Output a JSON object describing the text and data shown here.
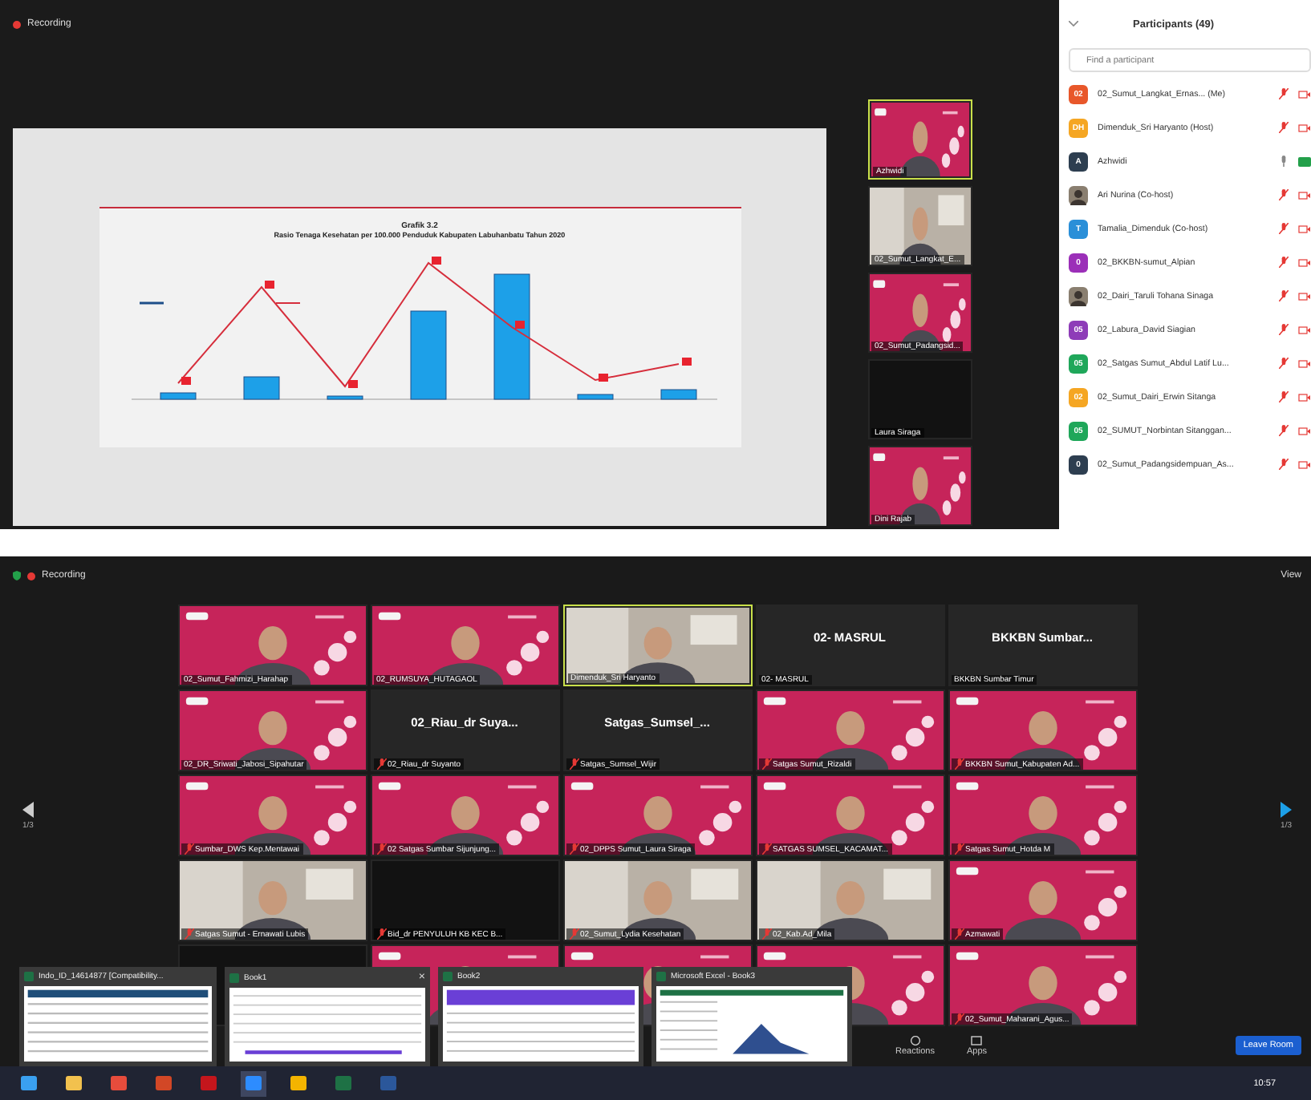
{
  "meeting_top": {
    "recording": "Recording",
    "slide": {
      "title": "Grafik 3.2",
      "subtitle": "Rasio Tenaga Kesehatan per 100.000 Penduduk Kabupaten Labuhanbatu Tahun 2020"
    },
    "speaker_strip": [
      {
        "name": "Azhwidi",
        "active": true,
        "kind": "backdrop"
      },
      {
        "name": "02_Sumut_Langkat_E...",
        "active": false,
        "kind": "room"
      },
      {
        "name": "02_Sumut_Padangsid...",
        "active": false,
        "kind": "backdrop"
      },
      {
        "name": "Laura Siraga",
        "active": false,
        "kind": "dark"
      },
      {
        "name": "Dini Rajab",
        "active": false,
        "kind": "backdrop"
      }
    ]
  },
  "participants_panel": {
    "title": "Participants (49)",
    "search": {
      "placeholder": "Find a participant"
    },
    "items": [
      {
        "kind": "initials",
        "initials": "02",
        "color": "#e8572a",
        "name": "02_Sumut_Langkat_Ernas... (Me)",
        "muted": true,
        "video_on": false
      },
      {
        "kind": "initials",
        "initials": "DH",
        "color": "#f5a623",
        "name": "Dimenduk_Sri Haryanto (Host)",
        "muted": true,
        "video_on": false
      },
      {
        "kind": "initials",
        "initials": "A",
        "color": "#2d3e50",
        "name": "Azhwidi",
        "muted": false,
        "video_on": true
      },
      {
        "name": "Ari Nurina (Co-host)",
        "muted": true,
        "video_on": false
      },
      {
        "kind": "initials",
        "initials": "T",
        "color": "#2a8fd8",
        "name": "Tamalia_Dimenduk (Co-host)",
        "muted": true,
        "video_on": false
      },
      {
        "kind": "initials",
        "initials": "0",
        "color": "#9b2fb8",
        "name": "02_BKKBN-sumut_Alpian",
        "muted": true,
        "video_on": false
      },
      {
        "name": "02_Dairi_Taruli Tohana Sinaga",
        "muted": true,
        "video_on": false
      },
      {
        "kind": "initials",
        "initials": "05",
        "color": "#8e3cb8",
        "name": "02_Labura_David Siagian",
        "muted": true,
        "video_on": false
      },
      {
        "kind": "initials",
        "initials": "05",
        "color": "#1fa75a",
        "name": "02_Satgas Sumut_Abdul Latif Lu...",
        "muted": true,
        "video_on": false
      },
      {
        "kind": "initials",
        "initials": "02",
        "color": "#f5a623",
        "name": "02_Sumut_Dairi_Erwin Sitanga",
        "muted": true,
        "video_on": false
      },
      {
        "kind": "initials",
        "initials": "05",
        "color": "#1fa75a",
        "name": "02_SUMUT_Norbintan Sitanggan...",
        "muted": true,
        "video_on": false
      },
      {
        "kind": "initials",
        "initials": "0",
        "color": "#2d3e50",
        "name": "02_Sumut_Padangsidempuan_As...",
        "muted": true,
        "video_on": false
      }
    ]
  },
  "meeting_bottom": {
    "recording": "Recording",
    "view": "View",
    "page_left": "1/3",
    "page_right": "1/3",
    "tiles": [
      {
        "kind": "backdrop",
        "name": "02_Sumut_Fahmizi_Harahap",
        "active": false,
        "muted": false
      },
      {
        "kind": "backdrop",
        "name": "02_RUMSUYA_HUTAGAOL",
        "active": false,
        "muted": false
      },
      {
        "kind": "room",
        "name": "Dimenduk_Sri Haryanto",
        "active": true,
        "muted": false
      },
      {
        "kind": "name",
        "big_name": "02- MASRUL",
        "name": "02- MASRUL",
        "active": false,
        "muted": false
      },
      {
        "kind": "name",
        "big_name": "BKKBN Sumbar...",
        "name": "BKKBN Sumbar Timur",
        "active": false,
        "muted": false
      },
      {
        "kind": "backdrop",
        "name": "02_DR_Sriwati_Jabosi_Sipahutar",
        "active": false,
        "muted": false
      },
      {
        "kind": "name",
        "big_name": "02_Riau_dr Suya...",
        "name": "02_Riau_dr Suyanto",
        "active": false,
        "muted": true
      },
      {
        "kind": "name",
        "big_name": "Satgas_Sumsel_...",
        "name": "Satgas_Sumsel_Wijir",
        "active": false,
        "muted": true
      },
      {
        "kind": "backdrop",
        "name": "Satgas Sumut_Rizaldi",
        "active": false,
        "muted": true
      },
      {
        "kind": "backdrop",
        "name": "BKKBN Sumut_Kabupaten Ad...",
        "active": false,
        "muted": true
      },
      {
        "kind": "backdrop",
        "name": "Sumbar_DWS Kep.Mentawai",
        "active": false,
        "muted": true
      },
      {
        "kind": "backdrop",
        "name": "02 Satgas Sumbar Sijunjung...",
        "active": false,
        "muted": true
      },
      {
        "kind": "backdrop",
        "name": "02_DPPS Sumut_Laura Siraga",
        "active": false,
        "muted": true
      },
      {
        "kind": "backdrop",
        "name": "SATGAS SUMSEL_KACAMAT...",
        "active": false,
        "muted": true
      },
      {
        "kind": "backdrop",
        "name": "Satgas Sumut_Hotda M",
        "active": false,
        "muted": true
      },
      {
        "kind": "room",
        "name": "Satgas Sumut - Ernawati Lubis",
        "active": false,
        "muted": true
      },
      {
        "kind": "dark",
        "name": "Bid_dr PENYULUH KB KEC B...",
        "active": false,
        "muted": true
      },
      {
        "kind": "room",
        "name": "02_Sumut_Lydia Kesehatan",
        "active": false,
        "muted": true
      },
      {
        "kind": "room",
        "name": "02_Kab.Ad_Mila",
        "active": false,
        "muted": true
      },
      {
        "kind": "backdrop",
        "name": "Azmawati",
        "active": false,
        "muted": true
      },
      {
        "kind": "dark",
        "active": false
      },
      {
        "kind": "backdrop",
        "active": false
      },
      {
        "kind": "backdrop",
        "active": false
      },
      {
        "kind": "backdrop",
        "active": false
      },
      {
        "kind": "backdrop",
        "name": "02_Sumut_Maharani_Agus...",
        "active": false,
        "muted": true
      }
    ],
    "toolbar": [
      {
        "kind": "reactions",
        "label": "Reactions"
      },
      {
        "kind": "apps",
        "label": "Apps"
      }
    ],
    "leave": "Leave Room"
  },
  "taskbar_previews": [
    {
      "title": "Indo_ID_14614877 [Compatibility...",
      "kind": "table"
    },
    {
      "title": "Book1",
      "close": "×",
      "kind": "grid"
    },
    {
      "title": "Book2",
      "kind": "banner"
    },
    {
      "title": "Microsoft Excel - Book3",
      "kind": "chart"
    }
  ],
  "taskbar": {
    "apps": [
      {
        "kind": "start",
        "active": false
      },
      {
        "kind": "explorer",
        "active": false
      },
      {
        "kind": "chrome",
        "active": false
      },
      {
        "kind": "powerpoint",
        "active": false
      },
      {
        "kind": "acrobat",
        "active": false
      },
      {
        "kind": "zoom",
        "active": true
      },
      {
        "kind": "folder",
        "active": false
      },
      {
        "kind": "excel",
        "active": false
      },
      {
        "kind": "word",
        "active": false
      }
    ],
    "time": "10:57"
  }
}
